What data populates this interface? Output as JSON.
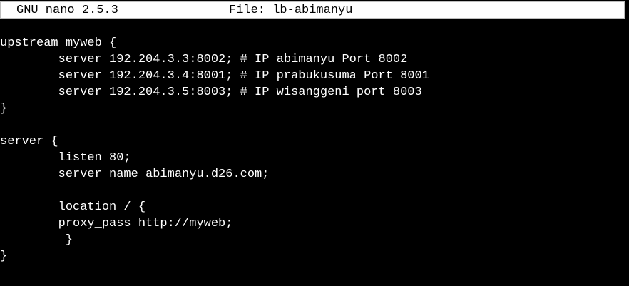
{
  "titlebar": {
    "app_name": "GNU nano 2.5.3",
    "file_label": "File: lb-abimanyu"
  },
  "editor": {
    "lines": [
      "upstream myweb {",
      "        server 192.204.3.3:8002; # IP abimanyu Port 8002",
      "        server 192.204.3.4:8001; # IP prabukusuma Port 8001",
      "        server 192.204.3.5:8003; # IP wisanggeni port 8003",
      "}",
      "",
      "server {",
      "        listen 80;",
      "        server_name abimanyu.d26.com;",
      "",
      "        location / {",
      "        proxy_pass http://myweb;",
      "         }",
      "}"
    ]
  },
  "colors": {
    "background": "#000000",
    "foreground": "#ffffff",
    "titlebar_bg": "#ffffff",
    "titlebar_fg": "#000000"
  }
}
